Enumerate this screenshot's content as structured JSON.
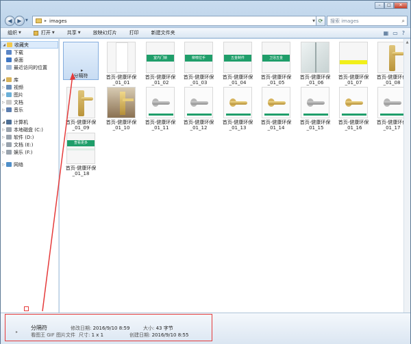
{
  "address": {
    "path": "images",
    "search_placeholder": "搜索 images"
  },
  "window_controls": {
    "minimize": "–",
    "maximize": "□",
    "close": "✕"
  },
  "toolbar": {
    "organize": "组织",
    "open": "打开",
    "share": "共享",
    "slideshow": "放映幻灯片",
    "print": "打印",
    "new_folder": "新建文件夹"
  },
  "nav_pane": {
    "favorites": "收藏夹",
    "downloads": "下载",
    "desktop": "桌面",
    "recent": "最近访问的位置",
    "libraries": "库",
    "videos": "视频",
    "pictures": "图片",
    "documents": "文档",
    "music": "音乐",
    "computer": "计算机",
    "drive_c": "本地磁盘 (C:)",
    "drive_d": "软件 (D:)",
    "drive_e": "文档 (E:)",
    "drive_f": "娱乐 (F:)",
    "network": "网络"
  },
  "files": [
    {
      "name": "分隔符",
      "thumb": "selected"
    },
    {
      "name": "首页-健康环保_01_01",
      "thumb": "white"
    },
    {
      "name": "首页-健康环保_01_02",
      "thumb": "green",
      "banner": "室内门锁"
    },
    {
      "name": "首页-健康环保_01_03",
      "thumb": "green",
      "banner": "柳榜拉手"
    },
    {
      "name": "首页-健康环保_01_04",
      "thumb": "green",
      "banner": "五金制件"
    },
    {
      "name": "首页-健康环保_01_05",
      "thumb": "green",
      "banner": "卫浴五金"
    },
    {
      "name": "首页-健康环保_01_06",
      "thumb": "glass"
    },
    {
      "name": "首页-健康环保_01_07",
      "thumb": "yellow"
    },
    {
      "name": "首页-健康环保_01_08",
      "thumb": "lock"
    },
    {
      "name": "首页-健康环保_01_09",
      "thumb": "lock"
    },
    {
      "name": "首页-健康环保_01_10",
      "thumb": "room"
    },
    {
      "name": "首页-健康环保_01_11",
      "thumb": "handle"
    },
    {
      "name": "首页-健康环保_01_12",
      "thumb": "handle"
    },
    {
      "name": "首页-健康环保_01_13",
      "thumb": "gold"
    },
    {
      "name": "首页-健康环保_01_14",
      "thumb": "gold"
    },
    {
      "name": "首页-健康环保_01_15",
      "thumb": "handle"
    },
    {
      "name": "首页-健康环保_01_16",
      "thumb": "gold"
    },
    {
      "name": "首页-健康环保_01_17",
      "thumb": "handle"
    },
    {
      "name": "首页-健康环保_01_18",
      "thumb": "more",
      "banner": "查看更多"
    }
  ],
  "details": {
    "name": "分隔符",
    "type": "看图王 GIF 图片文件",
    "modified_label": "修改日期:",
    "modified_value": "2016/9/10 8:59",
    "dimensions_label": "尺寸:",
    "dimensions_value": "1 x 1",
    "size_label": "大小:",
    "size_value": "43 字节",
    "created_label": "创建日期:",
    "created_value": "2016/9/10 8:55"
  },
  "colors": {
    "annotation": "#e53a3a",
    "accent_green": "#1f9e6a"
  }
}
